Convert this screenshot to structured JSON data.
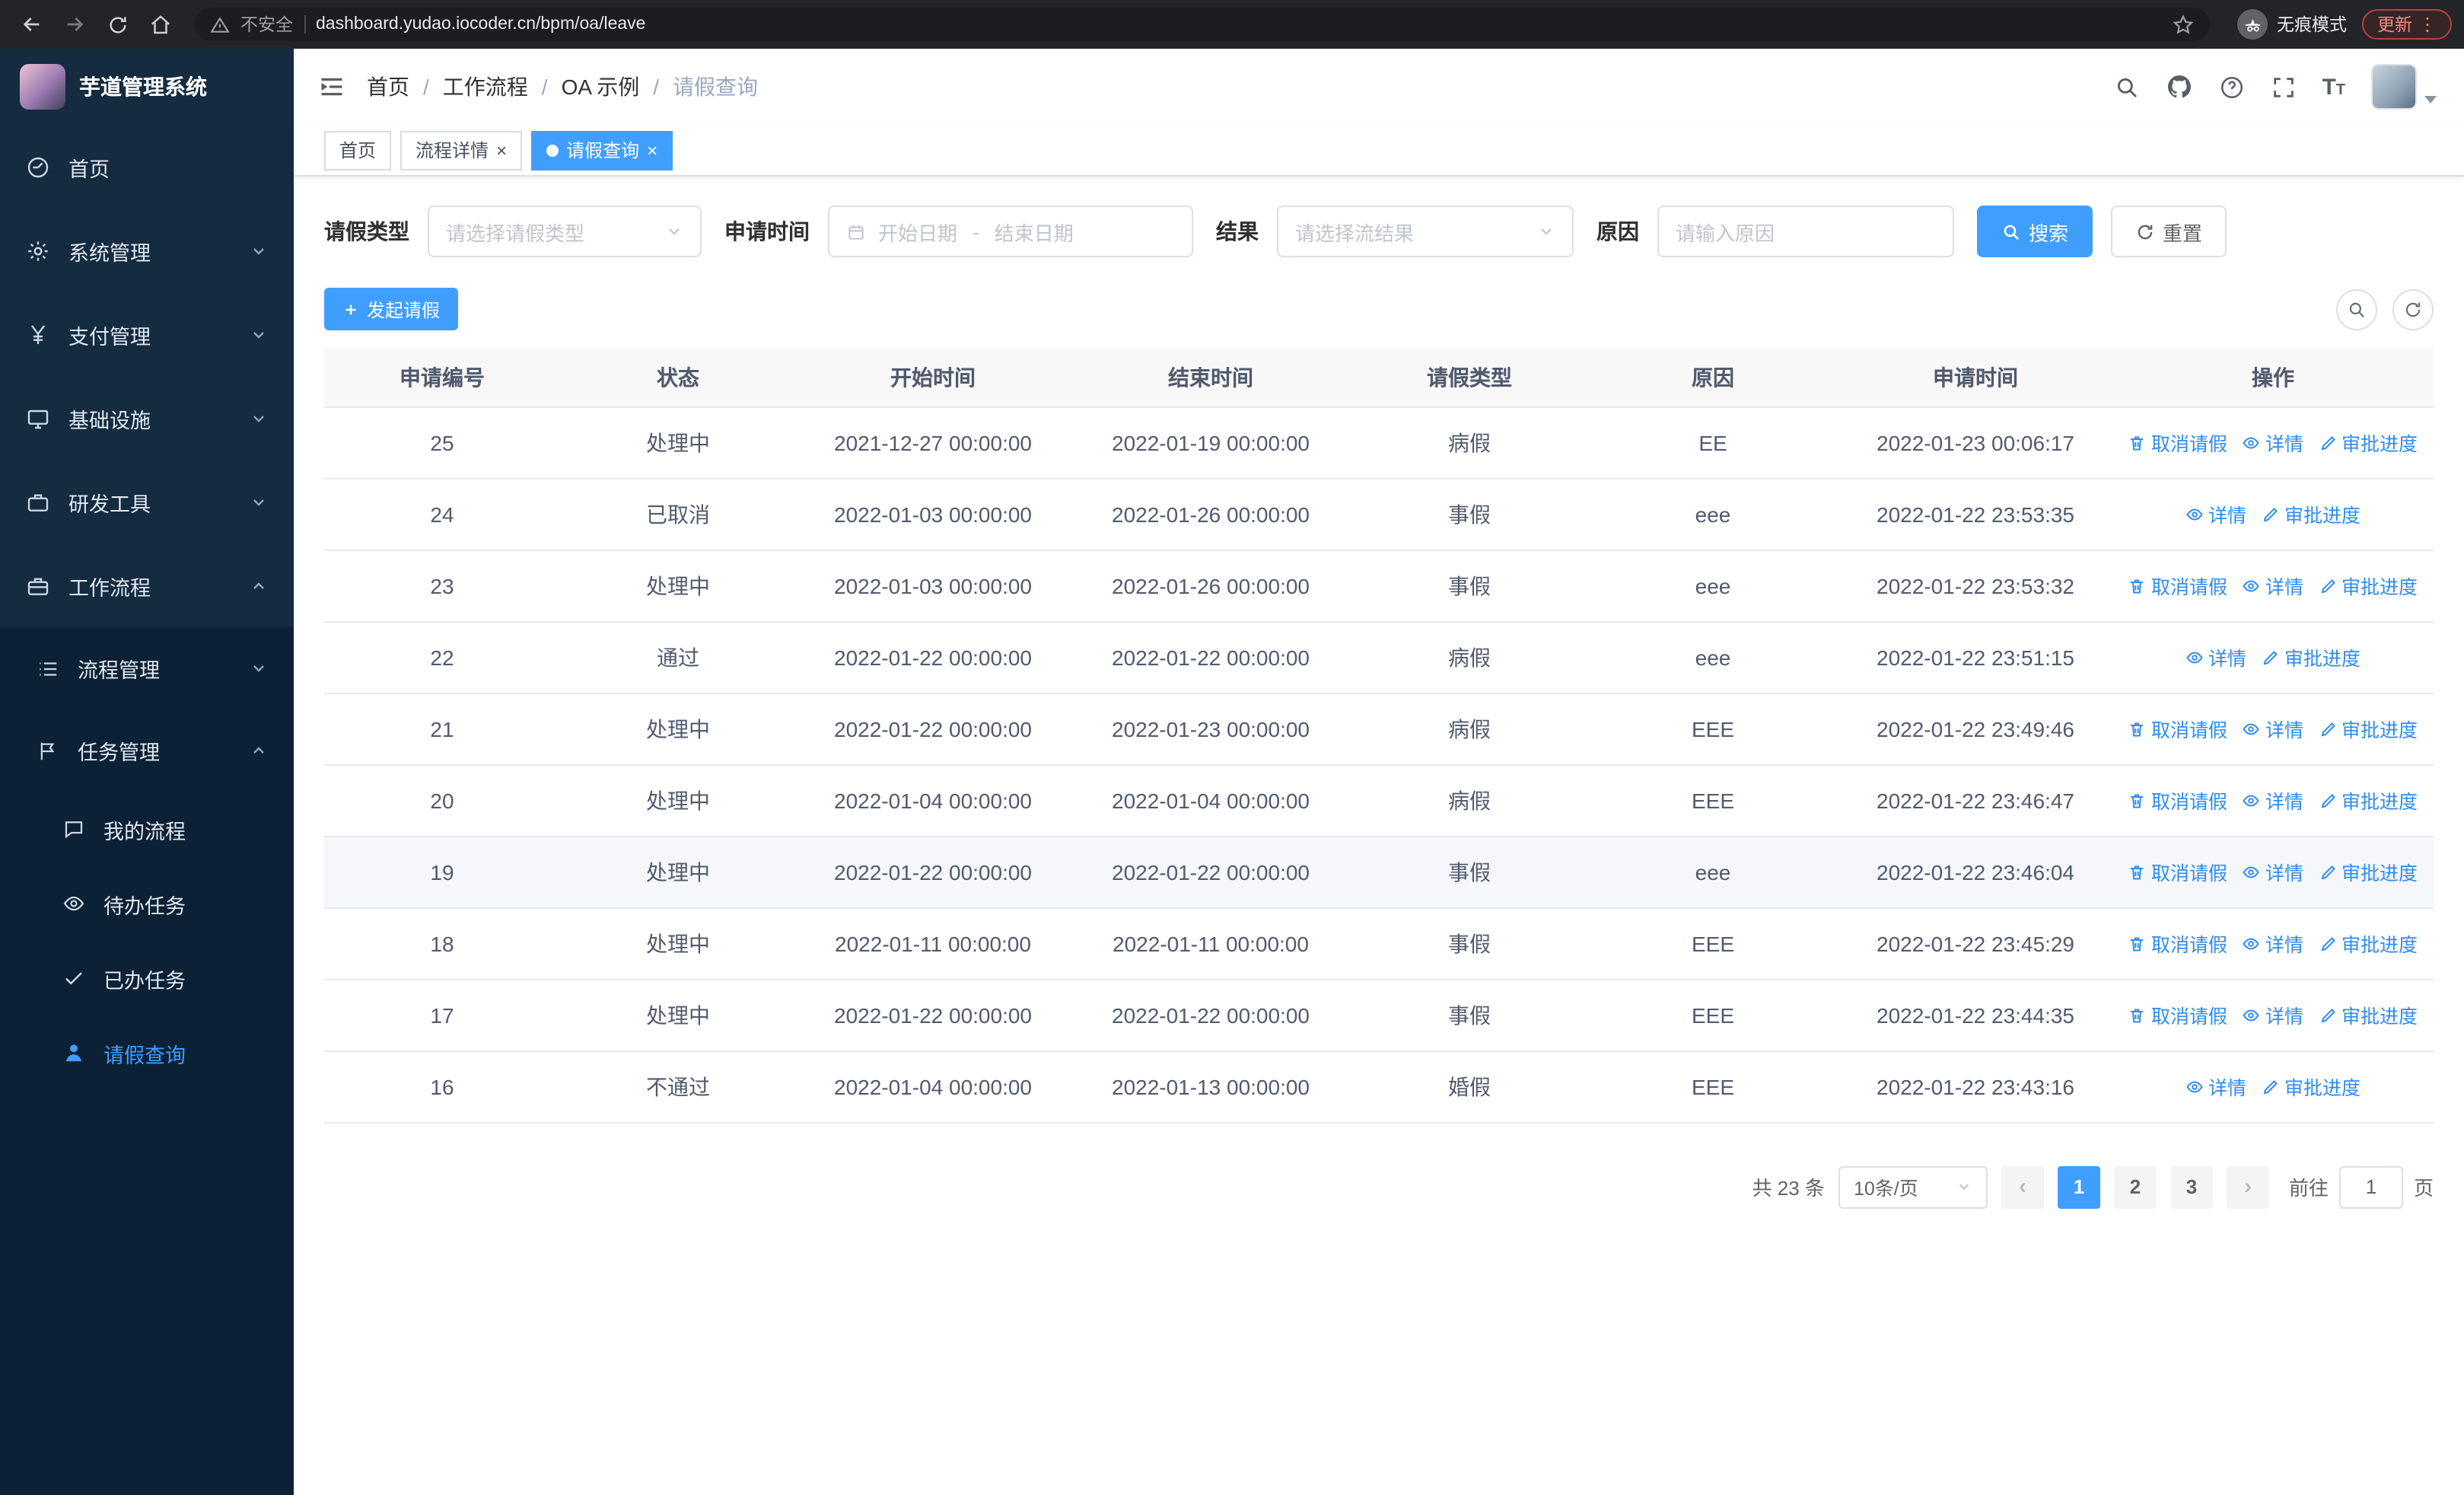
{
  "browser": {
    "security_label": "不安全",
    "url": "dashboard.yudao.iocoder.cn/bpm/oa/leave",
    "incognito_label": "无痕模式",
    "update_label": "更新"
  },
  "app": {
    "logo_title": "芋道管理系统",
    "accent_color": "#409eff",
    "sidebar_bg": "#142b40",
    "submenu_bg": "#0c2135"
  },
  "sidebar": {
    "items": [
      {
        "label": "首页",
        "icon": "dashboard-icon",
        "expandable": false
      },
      {
        "label": "系统管理",
        "icon": "gear-icon",
        "expandable": true
      },
      {
        "label": "支付管理",
        "icon": "yen-icon",
        "expandable": true
      },
      {
        "label": "基础设施",
        "icon": "monitor-icon",
        "expandable": true
      },
      {
        "label": "研发工具",
        "icon": "toolbox-icon",
        "expandable": true
      },
      {
        "label": "工作流程",
        "icon": "briefcase-icon",
        "expandable": true,
        "expanded": true
      }
    ],
    "workflow_children": [
      {
        "label": "流程管理",
        "icon": "list-icon",
        "expandable": true,
        "expanded": false
      },
      {
        "label": "任务管理",
        "icon": "flag-icon",
        "expandable": true,
        "expanded": true
      }
    ],
    "task_children": [
      {
        "label": "我的流程",
        "icon": "chat-icon",
        "active": false
      },
      {
        "label": "待办任务",
        "icon": "eye-icon",
        "active": false
      },
      {
        "label": "已办任务",
        "icon": "check-icon",
        "active": false
      },
      {
        "label": "请假查询",
        "icon": "user-icon",
        "active": true
      }
    ]
  },
  "header": {
    "breadcrumb": [
      "首页",
      "工作流程",
      "OA 示例",
      "请假查询"
    ]
  },
  "tabs": [
    {
      "label": "首页",
      "closable": false,
      "active": false
    },
    {
      "label": "流程详情",
      "closable": true,
      "active": false
    },
    {
      "label": "请假查询",
      "closable": true,
      "active": true
    }
  ],
  "filters": {
    "leave_type_label": "请假类型",
    "leave_type_placeholder": "请选择请假类型",
    "apply_time_label": "申请时间",
    "start_date_placeholder": "开始日期",
    "date_separator": "-",
    "end_date_placeholder": "结束日期",
    "result_label": "结果",
    "result_placeholder": "请选择流结果",
    "reason_label": "原因",
    "reason_placeholder": "请输入原因",
    "search_button": "搜索",
    "reset_button": "重置"
  },
  "toolbar": {
    "create_button": "发起请假"
  },
  "table": {
    "columns": [
      "申请编号",
      "状态",
      "开始时间",
      "结束时间",
      "请假类型",
      "原因",
      "申请时间",
      "操作"
    ],
    "action_labels": {
      "cancel": "取消请假",
      "detail": "详情",
      "progress": "审批进度"
    },
    "rows": [
      {
        "id": "25",
        "status": "处理中",
        "start": "2021-12-27 00:00:00",
        "end": "2022-01-19 00:00:00",
        "type": "病假",
        "reason": "EE",
        "applied": "2022-01-23 00:06:17",
        "actions": [
          "cancel",
          "detail",
          "progress"
        ],
        "highlighted": false
      },
      {
        "id": "24",
        "status": "已取消",
        "start": "2022-01-03 00:00:00",
        "end": "2022-01-26 00:00:00",
        "type": "事假",
        "reason": "eee",
        "applied": "2022-01-22 23:53:35",
        "actions": [
          "detail",
          "progress"
        ],
        "highlighted": false
      },
      {
        "id": "23",
        "status": "处理中",
        "start": "2022-01-03 00:00:00",
        "end": "2022-01-26 00:00:00",
        "type": "事假",
        "reason": "eee",
        "applied": "2022-01-22 23:53:32",
        "actions": [
          "cancel",
          "detail",
          "progress"
        ],
        "highlighted": false
      },
      {
        "id": "22",
        "status": "通过",
        "start": "2022-01-22 00:00:00",
        "end": "2022-01-22 00:00:00",
        "type": "病假",
        "reason": "eee",
        "applied": "2022-01-22 23:51:15",
        "actions": [
          "detail",
          "progress"
        ],
        "highlighted": false
      },
      {
        "id": "21",
        "status": "处理中",
        "start": "2022-01-22 00:00:00",
        "end": "2022-01-23 00:00:00",
        "type": "病假",
        "reason": "EEE",
        "applied": "2022-01-22 23:49:46",
        "actions": [
          "cancel",
          "detail",
          "progress"
        ],
        "highlighted": false
      },
      {
        "id": "20",
        "status": "处理中",
        "start": "2022-01-04 00:00:00",
        "end": "2022-01-04 00:00:00",
        "type": "病假",
        "reason": "EEE",
        "applied": "2022-01-22 23:46:47",
        "actions": [
          "cancel",
          "detail",
          "progress"
        ],
        "highlighted": false
      },
      {
        "id": "19",
        "status": "处理中",
        "start": "2022-01-22 00:00:00",
        "end": "2022-01-22 00:00:00",
        "type": "事假",
        "reason": "eee",
        "applied": "2022-01-22 23:46:04",
        "actions": [
          "cancel",
          "detail",
          "progress"
        ],
        "highlighted": true
      },
      {
        "id": "18",
        "status": "处理中",
        "start": "2022-01-11 00:00:00",
        "end": "2022-01-11 00:00:00",
        "type": "事假",
        "reason": "EEE",
        "applied": "2022-01-22 23:45:29",
        "actions": [
          "cancel",
          "detail",
          "progress"
        ],
        "highlighted": false
      },
      {
        "id": "17",
        "status": "处理中",
        "start": "2022-01-22 00:00:00",
        "end": "2022-01-22 00:00:00",
        "type": "事假",
        "reason": "EEE",
        "applied": "2022-01-22 23:44:35",
        "actions": [
          "cancel",
          "detail",
          "progress"
        ],
        "highlighted": false
      },
      {
        "id": "16",
        "status": "不通过",
        "start": "2022-01-04 00:00:00",
        "end": "2022-01-13 00:00:00",
        "type": "婚假",
        "reason": "EEE",
        "applied": "2022-01-22 23:43:16",
        "actions": [
          "detail",
          "progress"
        ],
        "highlighted": false
      }
    ]
  },
  "pagination": {
    "total_text": "共 23 条",
    "page_size": "10条/页",
    "pages": [
      "1",
      "2",
      "3"
    ],
    "active_page": "1",
    "goto_prefix": "前往",
    "goto_value": "1",
    "goto_suffix": "页"
  }
}
